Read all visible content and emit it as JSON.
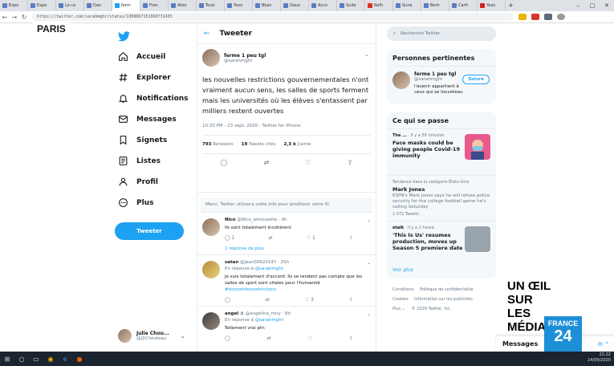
{
  "browser": {
    "tabs": [
      {
        "label": "Expo"
      },
      {
        "label": "Expo"
      },
      {
        "label": "Le ca"
      },
      {
        "label": "Dan"
      },
      {
        "label": "ferm"
      },
      {
        "label": "Fran"
      },
      {
        "label": "Akto"
      },
      {
        "label": "Toub"
      },
      {
        "label": "Yezo"
      },
      {
        "label": "Bkan"
      },
      {
        "label": "Daun"
      },
      {
        "label": "Acco"
      },
      {
        "label": "Sudo"
      },
      {
        "label": "Refh"
      },
      {
        "label": "Sune"
      },
      {
        "label": "Berh"
      },
      {
        "label": "Carfi"
      },
      {
        "label": "Yezo"
      }
    ],
    "url": "https://twitter.com/sarahmghr/status/1308667151960772435",
    "new_tab_label": "+",
    "min_label": "–",
    "max_label": "□",
    "close_label": "✕"
  },
  "overlays": {
    "city": "PARIS",
    "show_title_line1": "UN ŒIL SUR",
    "show_title_line2": "LES MÉDIAS",
    "channel_line1": "FRANCE",
    "channel_line2": "24"
  },
  "sidebar": {
    "items": [
      {
        "label": "Accueil"
      },
      {
        "label": "Explorer"
      },
      {
        "label": "Notifications"
      },
      {
        "label": "Messages"
      },
      {
        "label": "Signets"
      },
      {
        "label": "Listes"
      },
      {
        "label": "Profil"
      },
      {
        "label": "Plus"
      }
    ],
    "tweet_button": "Tweeter",
    "profile_name": "Julie Chou...",
    "profile_handle": "@J2Chouteau",
    "profile_chevron": "⌄"
  },
  "center": {
    "header_title": "Tweeter",
    "back_arrow": "←",
    "tweet": {
      "author_name": "ferme 1 peu tgl",
      "author_handle": "@sarahmghr",
      "more": "⌄",
      "text": "les nouvelles restrictions gouvernementales n'ont vraiment aucun sens, les salles de sports ferment mais les universités où les élèves s'entassent par milliers restent ouvertes",
      "timestamp": "10:33 PM - 23 sept. 2020 · Twitter for iPhone",
      "retweets_count": "793",
      "retweets_label": "Retweets",
      "quotes_count": "19",
      "quotes_label": "Tweets cités",
      "likes_count": "2,3 k",
      "likes_label": "J'aime"
    },
    "reply_notice": "Merci. Twitter utilisera cette info pour améliorer votre fil.",
    "replies": [
      {
        "name": "Nico",
        "meta": "@Nico_amouxette · 9h",
        "reply_to": "",
        "reply_to_handle": "",
        "text": "Ils sont totalement incohérent",
        "tag": "",
        "reply_count": "1",
        "retweet_count": "",
        "like_count": "1",
        "show_more": "1 réponse de plus"
      },
      {
        "name": "satan",
        "meta": "@jean00620147 · 25h",
        "reply_to": "En réponse à",
        "reply_to_handle": "@sarahmghr",
        "text": "Je suis totalement d'accord. Ils se rendent pas compte que les salles de sport sont vitales pour l'humanité",
        "tag": "#boycottlesrestrictions",
        "reply_count": "",
        "retweet_count": "",
        "like_count": "3",
        "show_more": ""
      },
      {
        "name": "angel ⚓",
        "meta": "@angelina_mny · 8h",
        "reply_to": "En réponse à",
        "reply_to_handle": "@sarahmghr",
        "text": "Tellement vrai ptn",
        "tag": "",
        "reply_count": "",
        "retweet_count": "",
        "like_count": "",
        "show_more": ""
      }
    ]
  },
  "right": {
    "search_placeholder": "Recherche Twitter",
    "people_title": "Personnes pertinentes",
    "person": {
      "name": "ferme 1 peu tgl",
      "handle": "@sarahmghr",
      "bio": "l'avenir appartient à ceux qui se louveteau",
      "follow_label": "Suivre"
    },
    "trends_title": "Ce qui se passe",
    "trends": [
      {
        "source": "The ...",
        "meta": "· Il y a 39 minutes",
        "title": "Face masks could be giving people Covid-19 immunity",
        "desc": "",
        "count": ""
      },
      {
        "source": "",
        "meta": "Tendance dans la catégorie États-Unis",
        "title": "Mark Jones",
        "desc": "ESPN's Mark Jones says he will refuse police security for the college football game he's calling Saturday",
        "count": "1 072 Tweets"
      },
      {
        "source": "etalk",
        "meta": "· Il y a 1 heure",
        "title": "'This Is Us' resumes production, moves up Season 5 premiere date",
        "desc": "",
        "count": ""
      }
    ],
    "see_more": "Voir plus",
    "footer": [
      "Conditions",
      "Politique de confidentialité",
      "Cookies",
      "Information sur les publicités",
      "Plus ⌄",
      "© 2020 Twitter, Inc."
    ]
  },
  "dock": {
    "messages_label": "Messages"
  },
  "taskbar": {
    "time": "22:22",
    "date": "24/09/2020"
  },
  "colors": {
    "accent": "#1da1f2",
    "channel_blue": "#1d8fd6"
  }
}
